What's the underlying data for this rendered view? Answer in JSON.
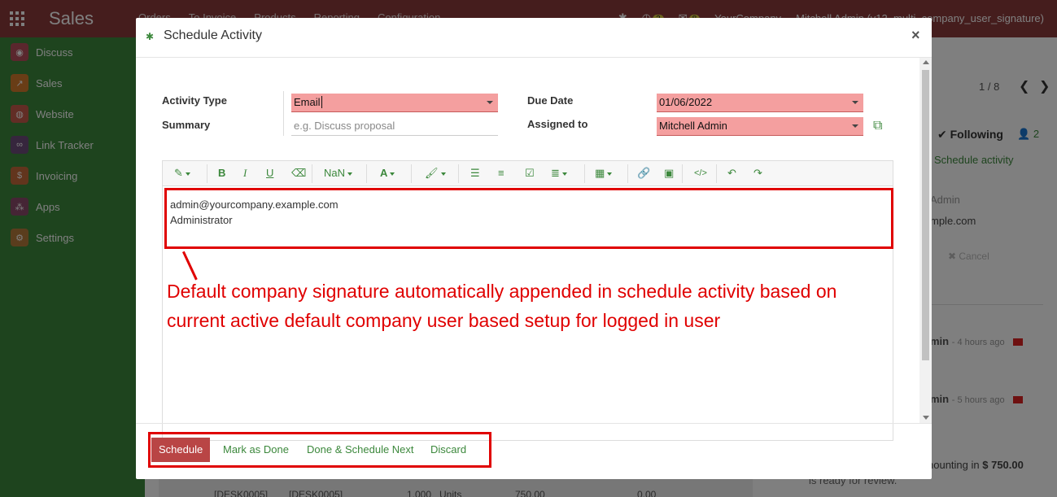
{
  "navbar": {
    "app_title": "Sales",
    "menu": [
      "Orders",
      "To Invoice",
      "Products",
      "Reporting",
      "Configuration"
    ],
    "activity_count": "3",
    "message_count": "8",
    "company": "YourCompany",
    "user": "Mitchell Admin (v12_multi_company_user_signature)"
  },
  "sidebar": {
    "items": [
      {
        "label": "Discuss",
        "icon": "chat-icon",
        "color": "#b54e5a"
      },
      {
        "label": "Sales",
        "icon": "chart-icon",
        "color": "#d37a2d"
      },
      {
        "label": "Website",
        "icon": "globe-icon",
        "color": "#c45a4a"
      },
      {
        "label": "Link Tracker",
        "icon": "link-icon",
        "color": "#6c4c7a"
      },
      {
        "label": "Invoicing",
        "icon": "invoice-icon",
        "color": "#c46a3a"
      },
      {
        "label": "Apps",
        "icon": "apps-icon",
        "color": "#8a4a6a"
      },
      {
        "label": "Settings",
        "icon": "gear-icon",
        "color": "#b57a3a"
      }
    ]
  },
  "background": {
    "pager": "1 / 8",
    "following": "Following",
    "followers": "2",
    "schedule_activity": "Schedule activity",
    "admin_partial": "Admin",
    "email_partial": "mple.com",
    "cancel": "Cancel",
    "log1_name": "min",
    "log1_time": "- 4 hours ago",
    "log2_name": "min",
    "log2_time": "- 5 hours ago",
    "amount_text": "nounting in",
    "amount_value": "$ 750.00",
    "review_text": "is ready for review.",
    "table_cells": [
      "[DESK0005]",
      "[DESK0005]",
      "1.000",
      "Units",
      "750.00",
      "0.00"
    ]
  },
  "modal": {
    "title": "Schedule Activity",
    "close": "×",
    "activity_type_label": "Activity Type",
    "activity_type_value": "Email",
    "summary_label": "Summary",
    "summary_placeholder": "e.g. Discuss proposal",
    "due_date_label": "Due Date",
    "due_date_value": "01/06/2022",
    "assigned_to_label": "Assigned to",
    "assigned_to_value": "Mitchell Admin",
    "toolbar": {
      "font_size": "NaN"
    },
    "signature_line1": "admin@yourcompany.example.com",
    "signature_line2": "Administrator",
    "annotation": "Default company signature automatically appended in schedule activity  based on current active default  company user  based setup for logged in user",
    "buttons": {
      "schedule": "Schedule",
      "mark_done": "Mark as Done",
      "done_schedule_next": "Done & Schedule Next",
      "discard": "Discard"
    }
  },
  "colors": {
    "accent": "#3c883c",
    "required_field": "#f49f9f",
    "annotation_red": "#e00000",
    "primary_button": "#b94545"
  }
}
